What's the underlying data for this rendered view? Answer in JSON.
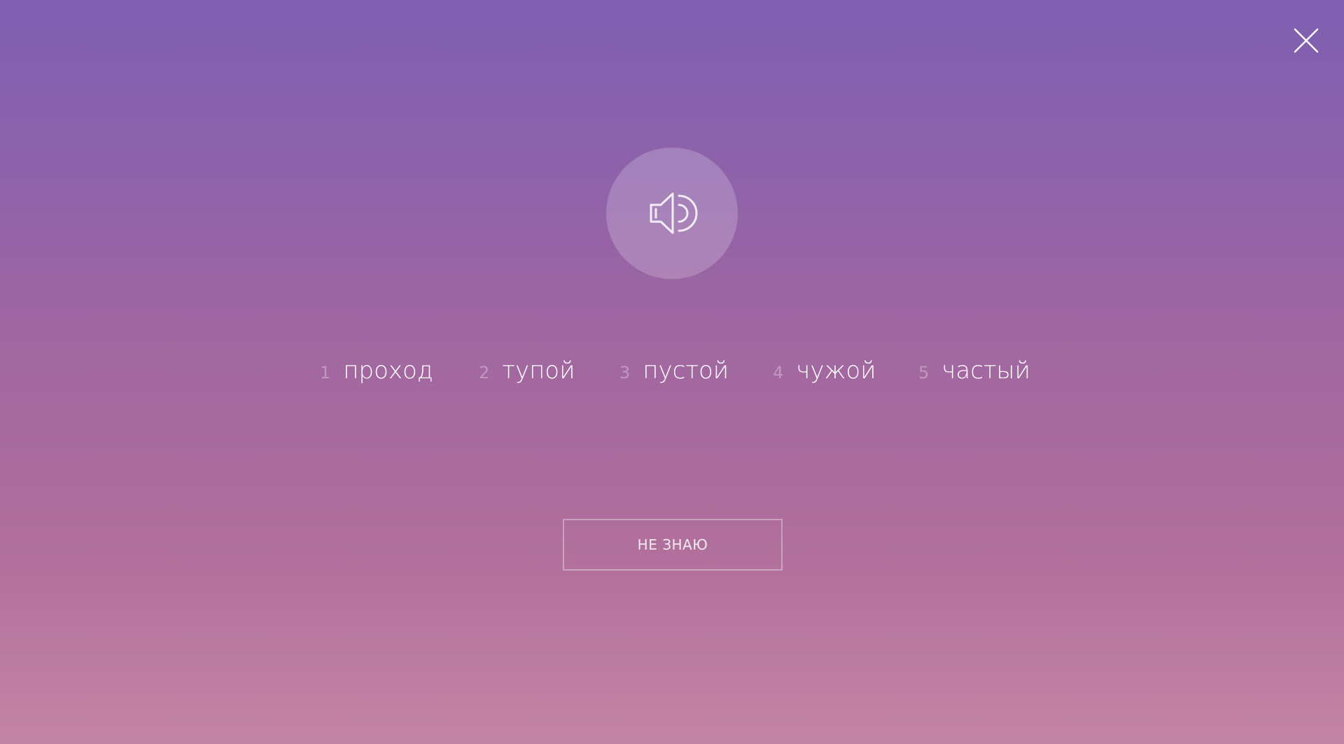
{
  "close": {
    "icon": "close-icon"
  },
  "sound": {
    "icon": "speaker-icon"
  },
  "options": [
    {
      "number": "1",
      "word": "проход"
    },
    {
      "number": "2",
      "word": "тупой"
    },
    {
      "number": "3",
      "word": "пустой"
    },
    {
      "number": "4",
      "word": "чужой"
    },
    {
      "number": "5",
      "word": "частый"
    }
  ],
  "dont_know_label": "НЕ ЗНАЮ",
  "colors": {
    "gradient_top": "#7e5fb1",
    "gradient_bottom": "#c384a4",
    "text": "#ffffff"
  }
}
